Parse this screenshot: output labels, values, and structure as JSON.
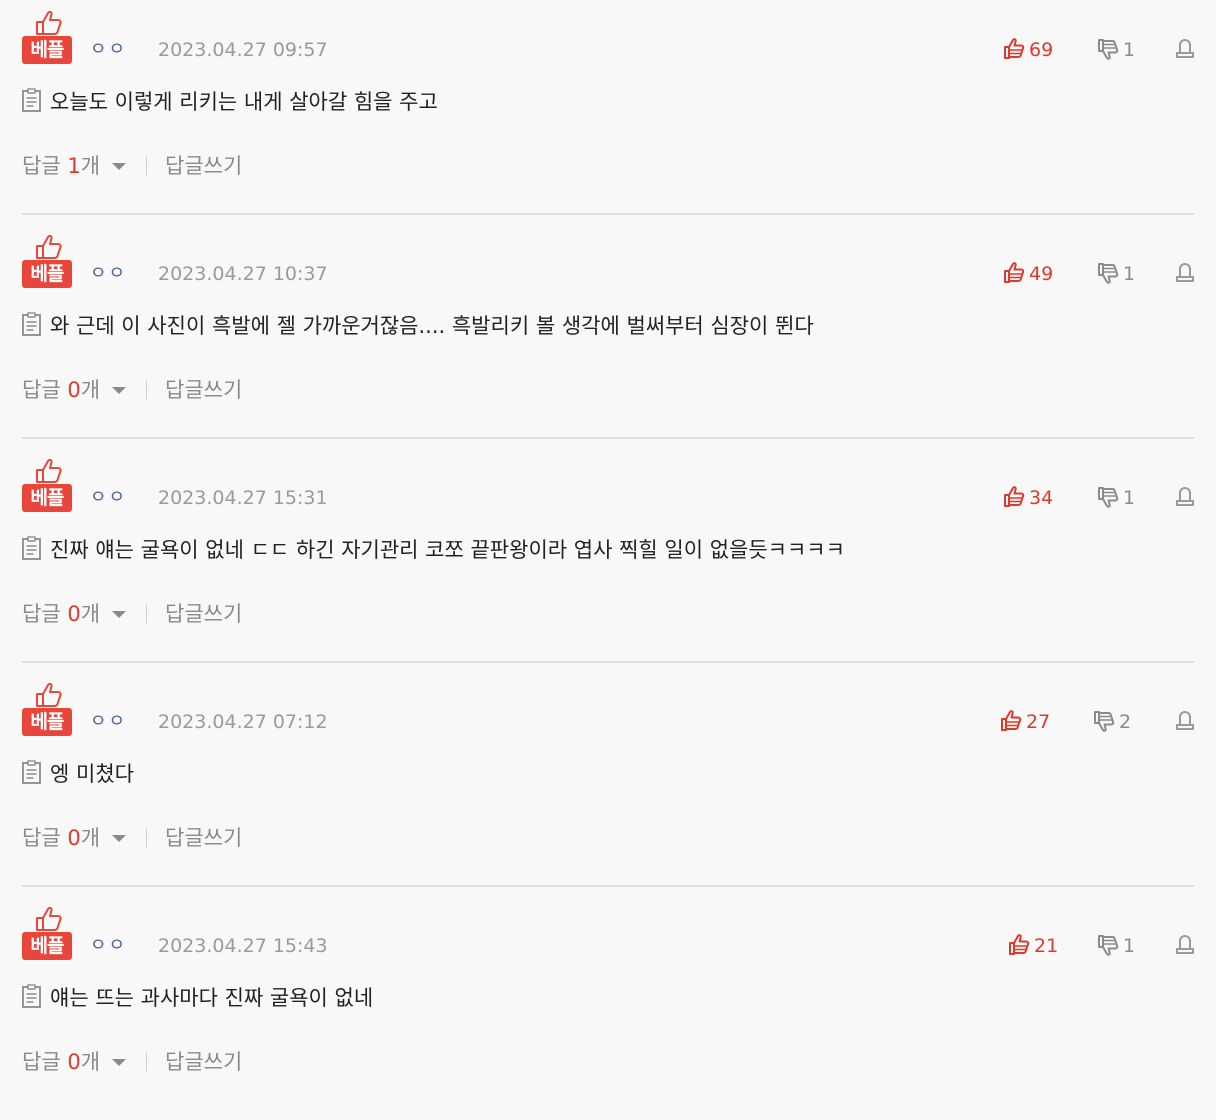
{
  "badge_label": "베플",
  "reply_label": "답글",
  "reply_unit": "개",
  "write_reply_label": "답글쓰기",
  "colors": {
    "accent": "#e0382b",
    "badge": "#e8463a",
    "nick": "#4b5f96",
    "muted": "#8a8a8a",
    "divider": "#dedede"
  },
  "icons": {
    "best": "thumbs-up-icon",
    "like": "thumbs-up-icon",
    "dislike": "thumbs-down-icon",
    "report": "report-icon",
    "memo": "memo-icon",
    "caret": "caret-down-icon"
  },
  "comments": [
    {
      "nickname": "ㅇㅇ",
      "date": "2023.04.27 09:57",
      "likes": "69",
      "dislikes": "1",
      "text": "오늘도 이렇게 리키는 내게 살아갈 힘을 주고",
      "reply_count": "1"
    },
    {
      "nickname": "ㅇㅇ",
      "date": "2023.04.27 10:37",
      "likes": "49",
      "dislikes": "1",
      "text": "와 근데 이 사진이 흑발에 젤 가까운거잖음.... 흑발리키 볼 생각에 벌써부터 심장이 뛴다",
      "reply_count": "0"
    },
    {
      "nickname": "ㅇㅇ",
      "date": "2023.04.27 15:31",
      "likes": "34",
      "dislikes": "1",
      "text": "진짜 얘는 굴욕이 없네 ㄷㄷ 하긴 자기관리 코쪼 끝판왕이라 엽사 찍힐 일이 없을듯ㅋㅋㅋㅋ",
      "reply_count": "0"
    },
    {
      "nickname": "ㅇㅇ",
      "date": "2023.04.27 07:12",
      "likes": "27",
      "dislikes": "2",
      "text": "엥 미쳤다",
      "reply_count": "0"
    },
    {
      "nickname": "ㅇㅇ",
      "date": "2023.04.27 15:43",
      "likes": "21",
      "dislikes": "1",
      "text": "얘는 뜨는 과사마다 진짜 굴욕이 없네",
      "reply_count": "0"
    }
  ]
}
